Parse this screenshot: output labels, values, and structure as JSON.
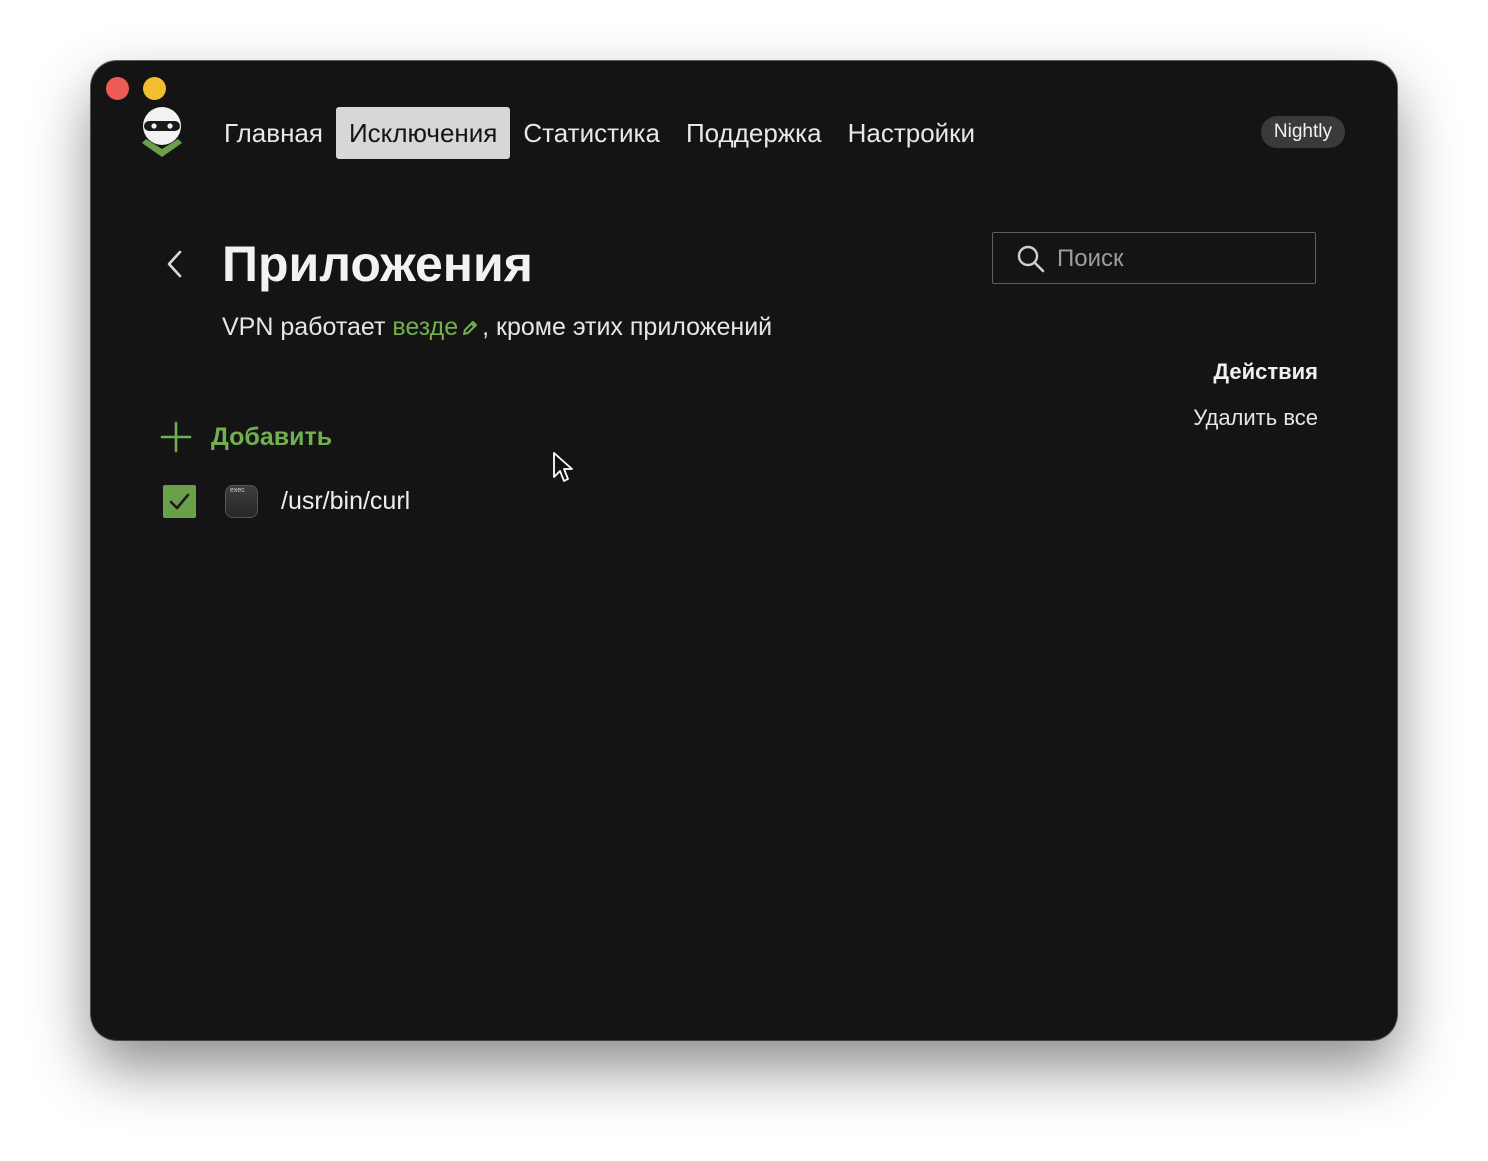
{
  "window": {
    "controls": [
      "close",
      "minimize"
    ]
  },
  "nav": {
    "items": [
      {
        "label": "Главная"
      },
      {
        "label": "Исключения",
        "active": true
      },
      {
        "label": "Статистика"
      },
      {
        "label": "Поддержка"
      },
      {
        "label": "Настройки"
      }
    ],
    "badge": "Nightly"
  },
  "page": {
    "title": "Приложения",
    "subtitle_prefix": "VPN работает ",
    "subtitle_link": "везде",
    "subtitle_suffix": ", кроме этих приложений"
  },
  "search": {
    "placeholder": "Поиск",
    "value": ""
  },
  "actions": {
    "heading": "Действия",
    "delete_all": "Удалить все"
  },
  "add": {
    "label": "Добавить"
  },
  "apps": [
    {
      "icon_text": "exec",
      "path": "/usr/bin/curl",
      "checked": true
    }
  ],
  "colors": {
    "accent": "#72b04f",
    "background": "#141414",
    "checkbox": "#6ba04a"
  }
}
